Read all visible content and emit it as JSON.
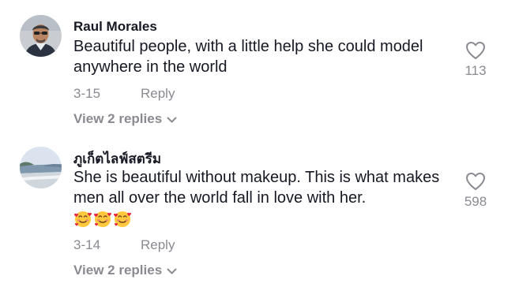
{
  "comments": [
    {
      "username": "Raul Morales",
      "text": "Beautiful people, with a little help she could model anywhere in the world",
      "date": "3-15",
      "reply_label": "Reply",
      "view_replies_label": "View 2 replies",
      "like_count": "113",
      "avatar_icon": "avatar-man-with-glasses"
    },
    {
      "username": "ภูเก็ตไลฟ์สตรีม",
      "text": "She is beautiful without makeup. This is what makes men all over the world fall in love with her.",
      "emojis": [
        "smiling-face-with-hearts",
        "smiling-face-with-hearts",
        "smiling-face-with-hearts"
      ],
      "date": "3-14",
      "reply_label": "Reply",
      "view_replies_label": "View 2 replies",
      "like_count": "598",
      "avatar_icon": "avatar-beach-scene"
    }
  ],
  "colors": {
    "text_primary": "#161823",
    "text_secondary": "#8a8b91",
    "emoji_face": "#ffc83d",
    "emoji_heart": "#e8213d"
  },
  "icons": {
    "like": "heart-outline-icon",
    "expand": "chevron-down-icon"
  }
}
